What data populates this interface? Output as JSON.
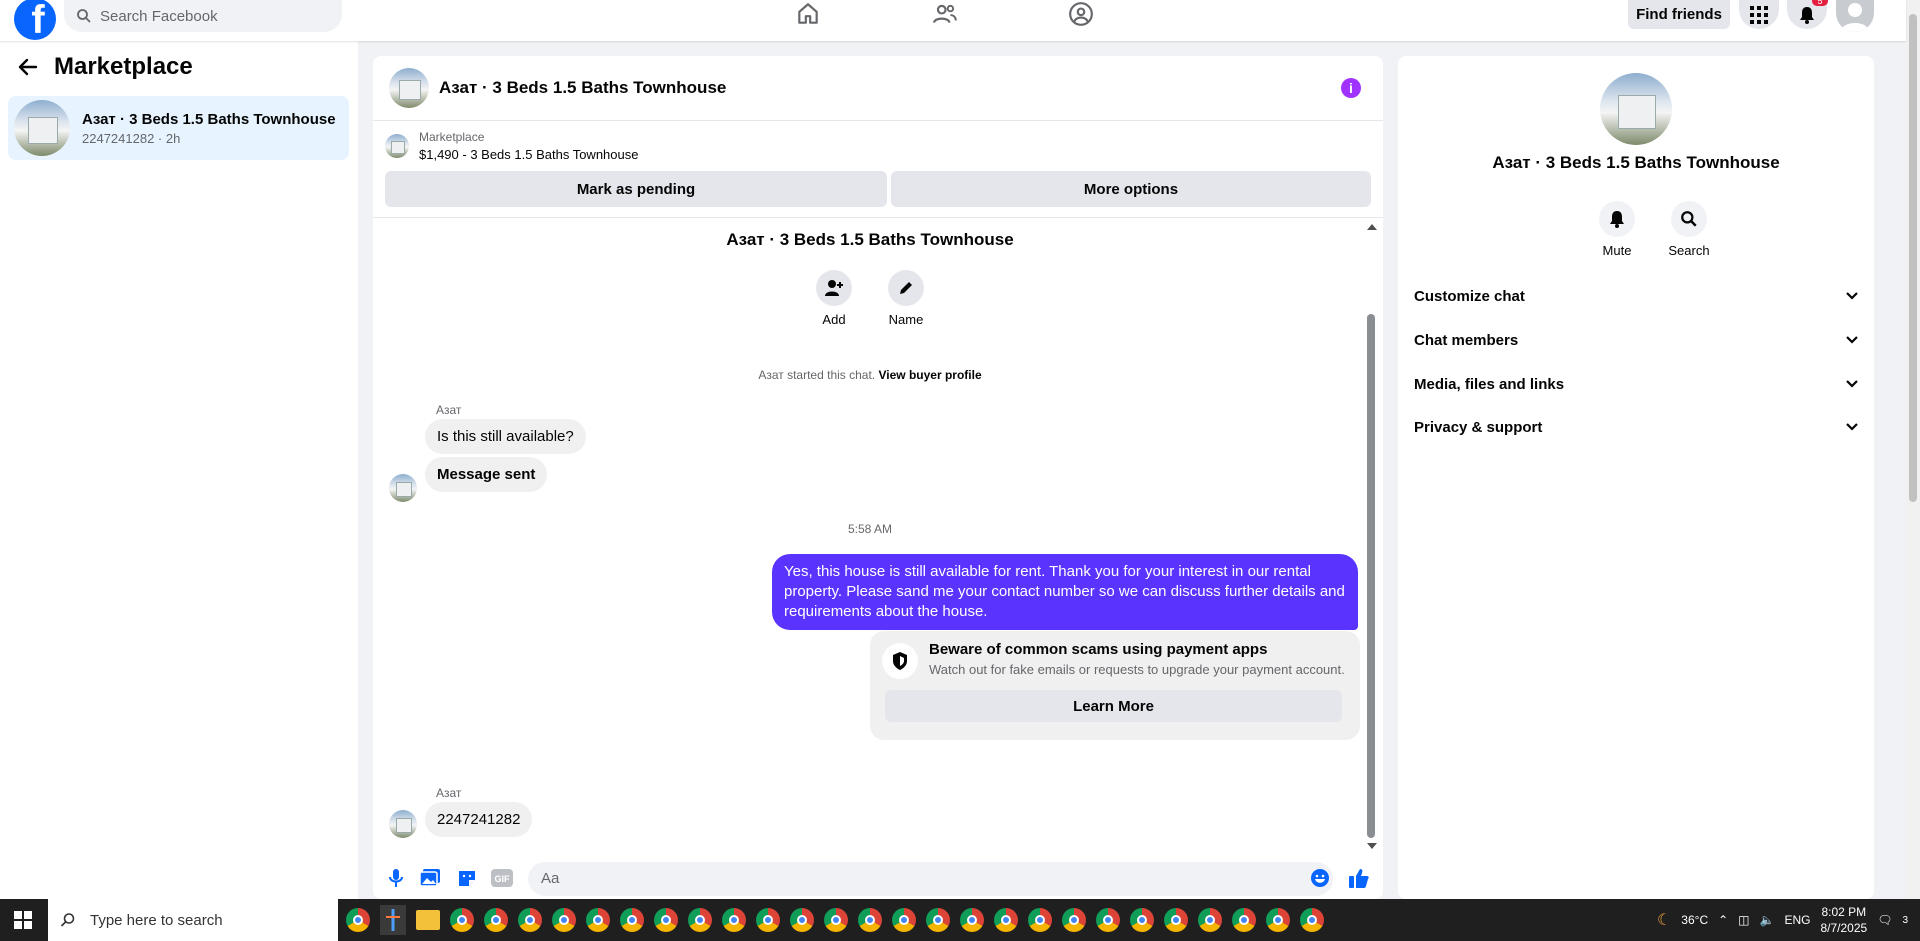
{
  "topbar": {
    "search_placeholder": "Search Facebook",
    "find_friends": "Find friends",
    "notification_count": "5",
    "logo_letter": "f"
  },
  "sidebar": {
    "title": "Marketplace",
    "conversation": {
      "name": "Азат · 3 Beds 1.5 Baths Townhouse",
      "sub": "2247241282 · 2h"
    }
  },
  "chat": {
    "header_title": "Азат · 3 Beds 1.5 Baths Townhouse",
    "info_glyph": "i",
    "listing_source": "Marketplace",
    "listing_detail": "$1,490 - 3 Beds 1.5 Baths Townhouse",
    "mark_pending": "Mark as pending",
    "more_options": "More options",
    "center_title": "Азат · 3 Beds 1.5 Baths Townhouse",
    "add_label": "Add",
    "name_label": "Name",
    "system_text": "Азат started this chat.",
    "view_profile": "View buyer profile",
    "sender1": "Азат",
    "msg1": "Is this still available?",
    "msg2": "Message sent",
    "timestamp": "5:58 AM",
    "outgoing": "Yes, this house is still available for rent. Thank you for your interest in our rental property. Please sand me your contact number so we can discuss further details and requirements about the house.",
    "warning_title": "Beware of common scams using payment apps",
    "warning_sub": "Watch out for fake emails or requests to upgrade your payment account.",
    "learn_more": "Learn More",
    "sender2": "Азат",
    "msg3": "2247241282",
    "composer_placeholder": "Aa",
    "gif_label": "GIF"
  },
  "rpanel": {
    "title": "Азат · 3 Beds 1.5 Baths Townhouse",
    "mute": "Mute",
    "search": "Search",
    "sections": [
      "Customize chat",
      "Chat members",
      "Media, files and links",
      "Privacy & support"
    ]
  },
  "taskbar": {
    "search_placeholder": "Type here to search",
    "weather": "36°C",
    "lang": "ENG",
    "time": "8:02 PM",
    "date": "8/7/2025",
    "notif": "3"
  },
  "colors": {
    "brand": "#0866ff",
    "outgoing_bubble": "#5b33ff",
    "info": "#a033ff"
  }
}
